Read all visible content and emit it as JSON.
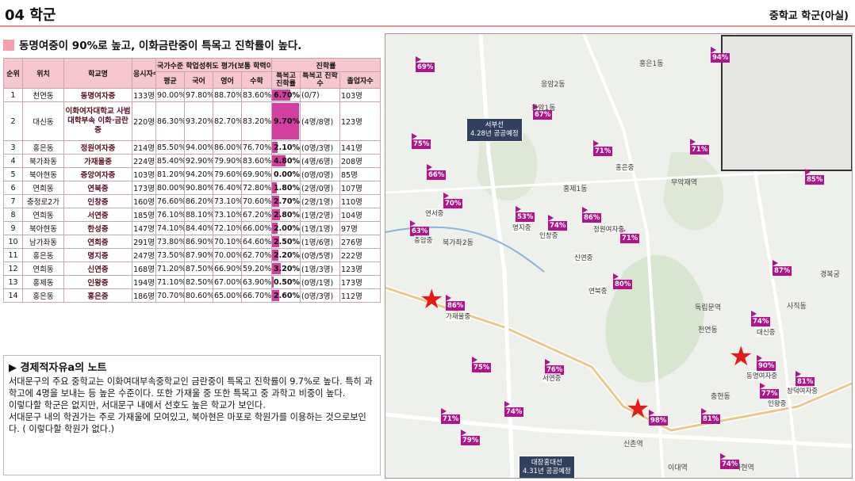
{
  "header": {
    "title": "04 학군",
    "right": "중학교 학군(아실)"
  },
  "subhead": "동명여중이 90%로 높고, 이화금란중이 특목고 진학률이 높다.",
  "table": {
    "headers": {
      "rank": "순위",
      "location": "위치",
      "school": "학교명",
      "applicants": "응시자수",
      "group": "국가수준 학업성취도 평가(보통 학력이상)",
      "avg": "평균",
      "kor": "국어",
      "eng": "영어",
      "math": "수학",
      "adv": "진학률",
      "adv_rate": "특목고 진학률",
      "adv_count": "특목고 진학수",
      "grads": "졸업자수"
    },
    "rows": [
      {
        "rank": "1",
        "loc": "천연동",
        "school": "동명여자중",
        "n": "133명",
        "avg": "90.00%",
        "kor": "97.80%",
        "eng": "88.70%",
        "math": "83.60%",
        "rate": "6.70%",
        "rv": 6.7,
        "cnt": "(0/7)",
        "grad": "103명"
      },
      {
        "rank": "2",
        "loc": "대신동",
        "school": "이화여자대학교 사범대학부속 이화·금란중",
        "n": "220명",
        "avg": "86.30%",
        "kor": "93.20%",
        "eng": "82.70%",
        "math": "83.20%",
        "rate": "9.70%",
        "rv": 9.7,
        "cnt": "(4명/8명)",
        "grad": "123명"
      },
      {
        "rank": "3",
        "loc": "홍은동",
        "school": "정원여자중",
        "n": "214명",
        "avg": "85.50%",
        "kor": "94.00%",
        "eng": "86.00%",
        "math": "76.70%",
        "rate": "2.10%",
        "rv": 2.1,
        "cnt": "(0명/3명)",
        "grad": "141명"
      },
      {
        "rank": "4",
        "loc": "북가좌동",
        "school": "가재울중",
        "n": "224명",
        "avg": "85.40%",
        "kor": "92.90%",
        "eng": "79.90%",
        "math": "83.60%",
        "rate": "4.80%",
        "rv": 4.8,
        "cnt": "(4명/6명)",
        "grad": "208명"
      },
      {
        "rank": "5",
        "loc": "북아현동",
        "school": "중앙여자중",
        "n": "103명",
        "avg": "81.20%",
        "kor": "94.20%",
        "eng": "79.60%",
        "math": "69.90%",
        "rate": "0.00%",
        "rv": 0,
        "cnt": "(0명/0명)",
        "grad": "85명"
      },
      {
        "rank": "6",
        "loc": "연희동",
        "school": "연북중",
        "n": "173명",
        "avg": "80.00%",
        "kor": "90.80%",
        "eng": "76.40%",
        "math": "72.80%",
        "rate": "1.80%",
        "rv": 1.8,
        "cnt": "(2명/0명)",
        "grad": "107명"
      },
      {
        "rank": "7",
        "loc": "충정로2가",
        "school": "인창중",
        "n": "160명",
        "avg": "76.60%",
        "kor": "86.20%",
        "eng": "73.10%",
        "math": "70.60%",
        "rate": "2.70%",
        "rv": 2.7,
        "cnt": "(2명/1명)",
        "grad": "110명"
      },
      {
        "rank": "8",
        "loc": "연희동",
        "school": "서연중",
        "n": "185명",
        "avg": "76.10%",
        "kor": "88.10%",
        "eng": "73.10%",
        "math": "67.20%",
        "rate": "2.80%",
        "rv": 2.8,
        "cnt": "(1명/2명)",
        "grad": "104명"
      },
      {
        "rank": "9",
        "loc": "북아현동",
        "school": "한성중",
        "n": "147명",
        "avg": "74.10%",
        "kor": "84.40%",
        "eng": "72.10%",
        "math": "66.00%",
        "rate": "2.00%",
        "rv": 2.0,
        "cnt": "(1명/1명)",
        "grad": "97명"
      },
      {
        "rank": "10",
        "loc": "남가좌동",
        "school": "연희중",
        "n": "291명",
        "avg": "73.80%",
        "kor": "86.90%",
        "eng": "70.10%",
        "math": "64.60%",
        "rate": "2.50%",
        "rv": 2.5,
        "cnt": "(1명/6명)",
        "grad": "276명"
      },
      {
        "rank": "11",
        "loc": "홍은동",
        "school": "명지중",
        "n": "247명",
        "avg": "73.50%",
        "kor": "87.90%",
        "eng": "70.00%",
        "math": "62.70%",
        "rate": "2.20%",
        "rv": 2.2,
        "cnt": "(0명/5명)",
        "grad": "222명"
      },
      {
        "rank": "12",
        "loc": "연희동",
        "school": "신연중",
        "n": "168명",
        "avg": "71.20%",
        "kor": "87.50%",
        "eng": "66.90%",
        "math": "59.20%",
        "rate": "3.20%",
        "rv": 3.2,
        "cnt": "(1명/3명)",
        "grad": "123명"
      },
      {
        "rank": "13",
        "loc": "홍제동",
        "school": "인왕중",
        "n": "194명",
        "avg": "71.10%",
        "kor": "82.50%",
        "eng": "67.00%",
        "math": "63.90%",
        "rate": "0.50%",
        "rv": 0.5,
        "cnt": "(0명/1명)",
        "grad": "173명"
      },
      {
        "rank": "14",
        "loc": "홍은동",
        "school": "홍은중",
        "n": "186명",
        "avg": "70.70%",
        "kor": "80.60%",
        "eng": "65.00%",
        "math": "66.70%",
        "rate": "2.60%",
        "rv": 2.6,
        "cnt": "(0명/3명)",
        "grad": "112명"
      }
    ]
  },
  "note": {
    "title": "▶ 경제적자유a의 노트",
    "p1": "서대문구의 주요 중학교는 이화여대부속중학교인 금란중이 특목고 진학률이 9.7%로 높다. 특히 과학고에 4명을 보내는 등 높은 수준이다. 또한 가재울 중 또한 특목고 중 과학고 비중이 높다.",
    "p2": "이렇다할 학군은 없지만, 서대문구 내에서 선호도 높은 학교가 보인다.",
    "p3": "서대문구 내의 학권가는 주로 가재울에 모여있고, 북아현은 마포로 학원가를 이용하는 것으로보인다. ( 이렇다할 학원가 없다.)"
  },
  "map": {
    "sign1": "서부선\n4.28년 공공예정",
    "sign2": "대장홍대선\n4.31년 공공예정",
    "pins": [
      "69%",
      "75%",
      "67%",
      "71%",
      "71%",
      "66%",
      "70%",
      "53%",
      "74%",
      "86%",
      "71%",
      "63%",
      "80%",
      "87%",
      "86%",
      "74%",
      "75%",
      "76%",
      "90%",
      "77%",
      "81%",
      "71%",
      "74%",
      "79%",
      "98%",
      "81%",
      "74%",
      "85%",
      "94%"
    ],
    "schools": [
      "연서중",
      "충암중",
      "명지중",
      "연북중",
      "정원여자중",
      "가재울중",
      "서연중",
      "동명여자중",
      "인왕중",
      "신연중",
      "홍은중",
      "인창중",
      "대신중",
      "창덕여자중"
    ],
    "dongs": [
      "홍은1동",
      "응암2동",
      "응암1동",
      "북가좌2동",
      "홍제1동",
      "무악재역",
      "독립문역",
      "신촌역",
      "이대역",
      "아현역",
      "천연동",
      "충현동",
      "사직동",
      "경복궁"
    ]
  }
}
